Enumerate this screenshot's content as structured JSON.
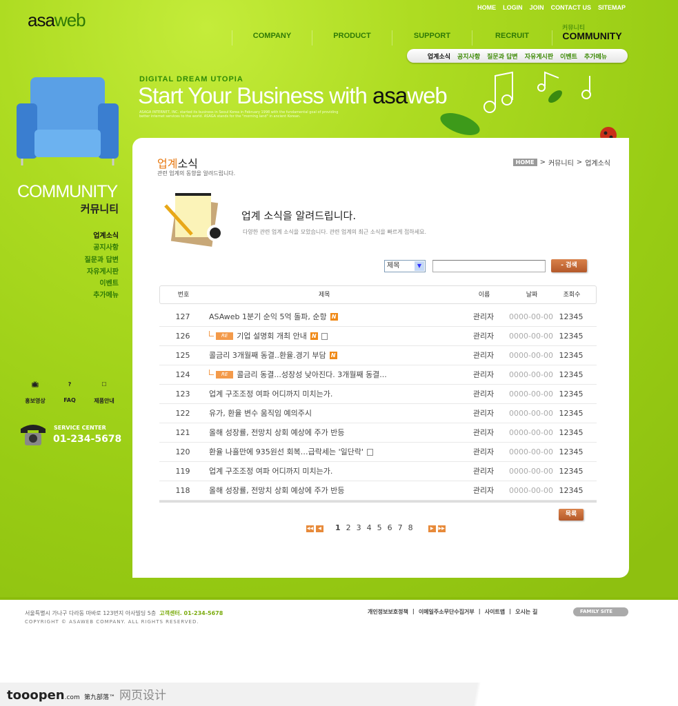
{
  "header": {
    "logo": {
      "bold": "asa",
      "rest": "web"
    },
    "util_links": [
      "HOME",
      "LOGIN",
      "JOIN",
      "CONTACT US",
      "SITEMAP"
    ],
    "nav": [
      "COMPANY",
      "PRODUCT",
      "SUPPORT",
      "RECRUIT",
      "COMMUNITY"
    ],
    "nav_active_ko": "커뮤니티",
    "subnav": [
      "업계소식",
      "공지사항",
      "질문과 답변",
      "자유게시판",
      "이벤트",
      "추가메뉴"
    ]
  },
  "banner": {
    "tagline": "DIGITAL DREAM UTOPIA",
    "slogan": "Start Your Business with ",
    "slogan_brand": "asa",
    "slogan_brand_rest": "web",
    "fine_print": "ASAGA INTERNET, INC. started its business in Seoul Korea in February 1998 with the fundamental goal of providing better internet services to the world. ASAGA stands for the \"morning land\" in ancient Korean."
  },
  "sidebar": {
    "title": "COMMUNITY",
    "title_ko": "커뮤니티",
    "menu": [
      "업계소식",
      "공지사항",
      "질문과 답변",
      "자유게시판",
      "이벤트",
      "추가메뉴"
    ],
    "quick": [
      {
        "icon": "tv-icon",
        "label": "홍보영상"
      },
      {
        "icon": "question-icon",
        "label": "FAQ"
      },
      {
        "icon": "catalog-icon",
        "label": "제품안내"
      }
    ],
    "service_label": "SERVICE CENTER",
    "service_phone": "01-234-5678"
  },
  "content": {
    "title_accent": "업계",
    "title_rest": "소식",
    "subtitle": "관련 업계의 동향을 알려드립니다.",
    "breadcrumb": [
      "HOME",
      "커뮤니티",
      "업계소식"
    ],
    "intro_heading": "업계 소식을 알려드립니다.",
    "intro_text": "다양한 관련 업계 소식을 모았습니다. 관련 업계의 최근 소식을 빠르게 접하세요.",
    "search": {
      "select_value": "제목",
      "input_value": "",
      "button": "- 검색"
    },
    "table": {
      "headers": [
        "번호",
        "제목",
        "이름",
        "날짜",
        "조회수"
      ],
      "rows": [
        {
          "no": "127",
          "title": "ASAweb 1분기 순익 5억 돌파, 순항",
          "reply": false,
          "new": true,
          "file": false,
          "name": "관리자",
          "date": "0000-00-00",
          "views": "12345"
        },
        {
          "no": "126",
          "title": "기업 설명회 개최 안내",
          "reply": true,
          "new": true,
          "file": true,
          "name": "관리자",
          "date": "0000-00-00",
          "views": "12345"
        },
        {
          "no": "125",
          "title": "콜금리 3개월째 동결..환율.경기 부담",
          "reply": false,
          "new": true,
          "file": false,
          "name": "관리자",
          "date": "0000-00-00",
          "views": "12345"
        },
        {
          "no": "124",
          "title": "콜금리 동결...성장성 낮아진다. 3개월째 동결...",
          "reply": true,
          "new": false,
          "file": false,
          "name": "관리자",
          "date": "0000-00-00",
          "views": "12345"
        },
        {
          "no": "123",
          "title": "업계 구조조정 여파 어디까지 미치는가.",
          "reply": false,
          "new": false,
          "file": false,
          "name": "관리자",
          "date": "0000-00-00",
          "views": "12345"
        },
        {
          "no": "122",
          "title": "유가, 환율 변수 움직임 예의주시",
          "reply": false,
          "new": false,
          "file": false,
          "name": "관리자",
          "date": "0000-00-00",
          "views": "12345"
        },
        {
          "no": "121",
          "title": "올해 성장률, 전망치 상회 예상에 주가 반등",
          "reply": false,
          "new": false,
          "file": false,
          "name": "관리자",
          "date": "0000-00-00",
          "views": "12345"
        },
        {
          "no": "120",
          "title": "환율 나흘만에 935원선 회복…급락세는 '일단락'",
          "reply": false,
          "new": false,
          "file": true,
          "name": "관리자",
          "date": "0000-00-00",
          "views": "12345"
        },
        {
          "no": "119",
          "title": "업계 구조조정 여파 어디까지 미치는가.",
          "reply": false,
          "new": false,
          "file": false,
          "name": "관리자",
          "date": "0000-00-00",
          "views": "12345"
        },
        {
          "no": "118",
          "title": "올해 성장률, 전망치 상회 예상에 주가 반등",
          "reply": false,
          "new": false,
          "file": false,
          "name": "관리자",
          "date": "0000-00-00",
          "views": "12345"
        }
      ]
    },
    "reply_badge": "RE",
    "new_badge": "N",
    "list_button": "목록",
    "pagination": {
      "pages": [
        "1",
        "2",
        "3",
        "4",
        "5",
        "6",
        "7",
        "8"
      ],
      "current": "1"
    }
  },
  "footer": {
    "address": "서울특별시 가나구 다라동 마바로 123번지 아사빌딩 5층",
    "cs": "고객센터. 01-234-5678",
    "copyright": "COPYRIGHT © ASAWEB COMPANY. ALL RIGHTS RESERVED.",
    "links": [
      "개인정보보호정책",
      "이메일주소무단수집거부",
      "사이트맵",
      "오시는 길"
    ],
    "family_site": "FAMILY SITE"
  },
  "watermark": {
    "brand": "tooopen",
    "domain": ".com",
    "cn": "第九部落™",
    "cat": "网页设计"
  },
  "colors": {
    "green": "#98cc14",
    "accent": "#e7770e",
    "dark_green": "#2f7a06"
  }
}
